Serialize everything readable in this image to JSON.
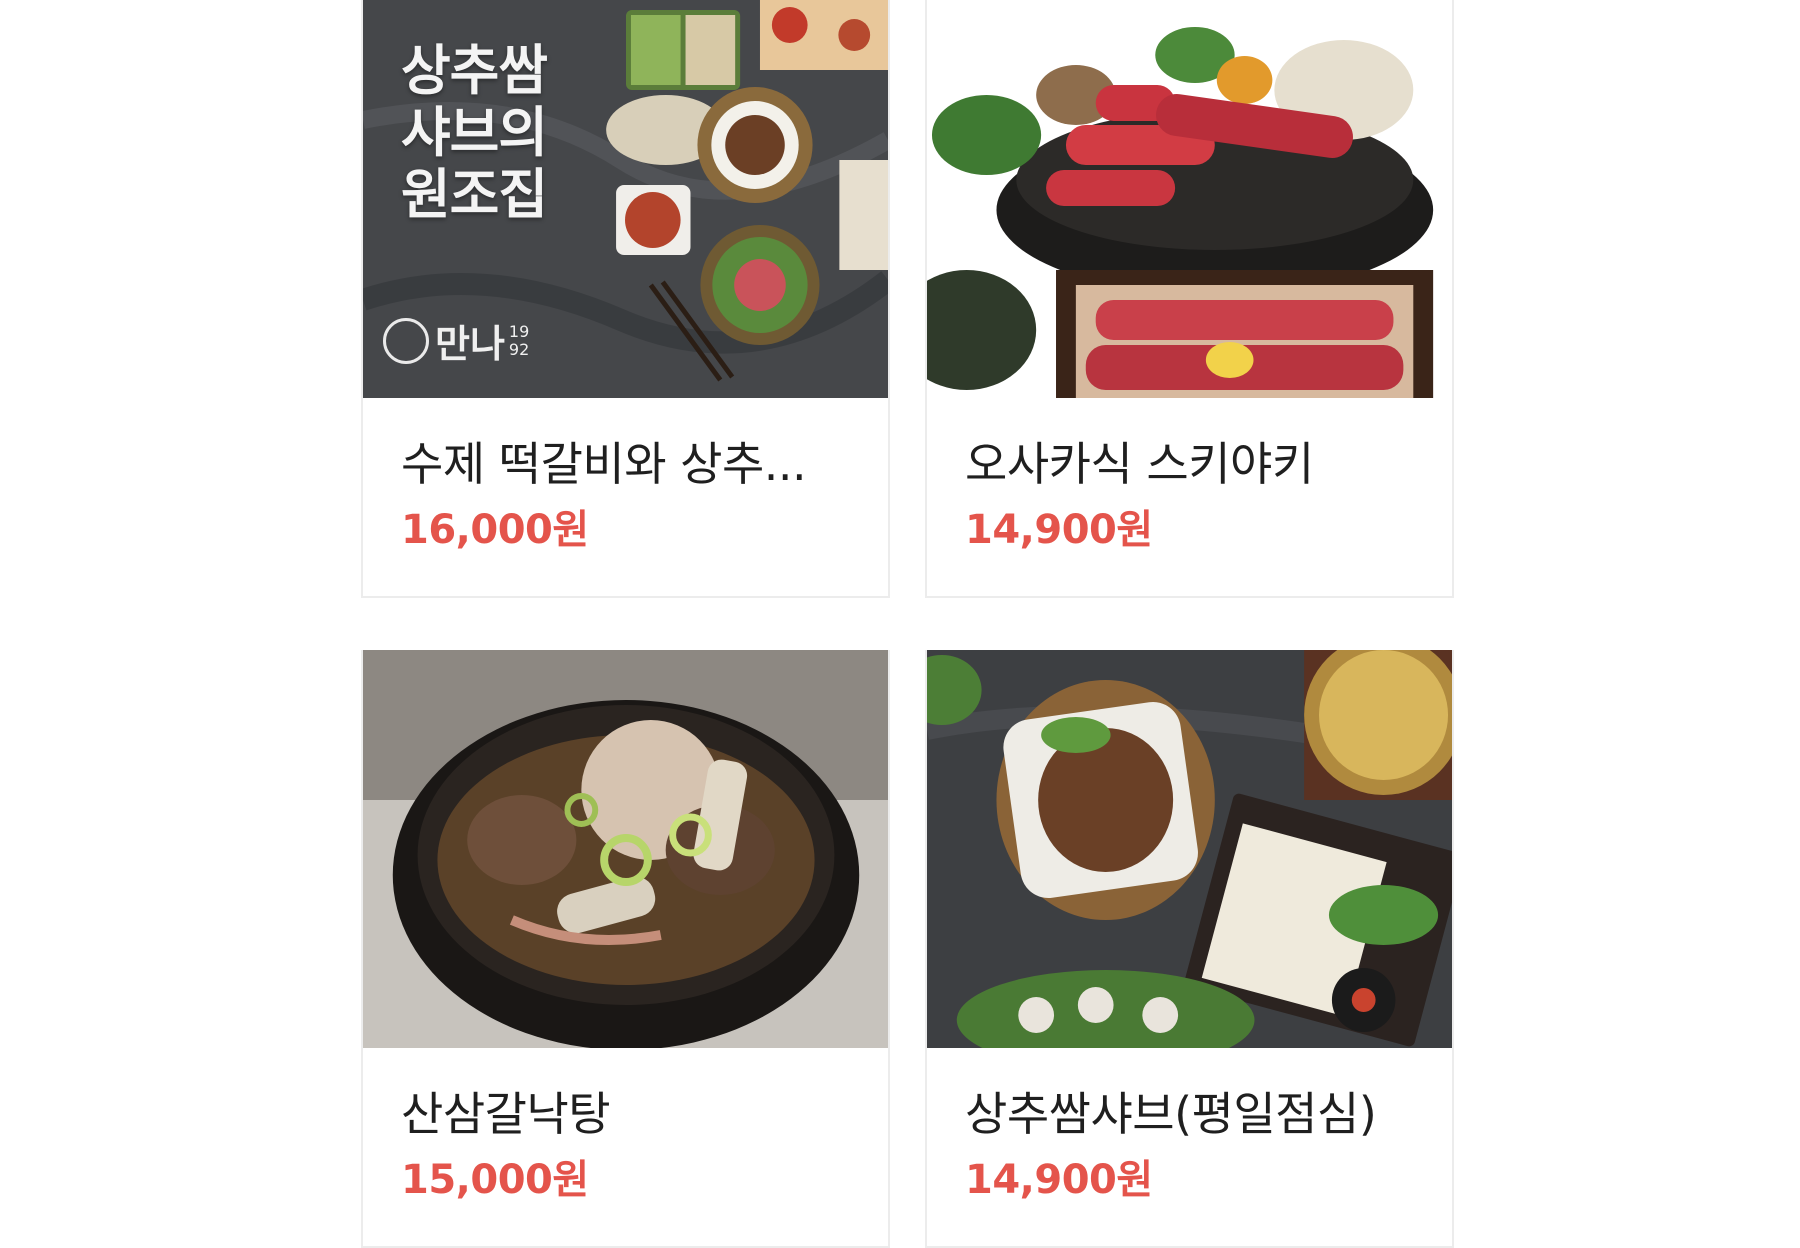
{
  "menu_items": [
    {
      "name": "수제 떡갈비와 상추...",
      "price": "16,000원",
      "image": "tteokgalbi-lettuce-shabu-set",
      "promo_lines": [
        "상추쌈",
        "샤브의",
        "원조집"
      ],
      "brand": "만나",
      "brand_year_top": "19",
      "brand_year_bottom": "92"
    },
    {
      "name": "오사카식 스키야키",
      "price": "14,900원",
      "image": "osaka-sukiyaki-beef"
    },
    {
      "name": "산삼갈낙탕",
      "price": "15,000원",
      "image": "galnaktang-octopus-rib-soup"
    },
    {
      "name": "상추쌈샤브(평일점심)",
      "price": "14,900원",
      "image": "lettuce-shabu-lunch-spread"
    }
  ],
  "colors": {
    "price": "#e4544b",
    "name": "#1f1f1f",
    "card_border": "#ececec"
  }
}
